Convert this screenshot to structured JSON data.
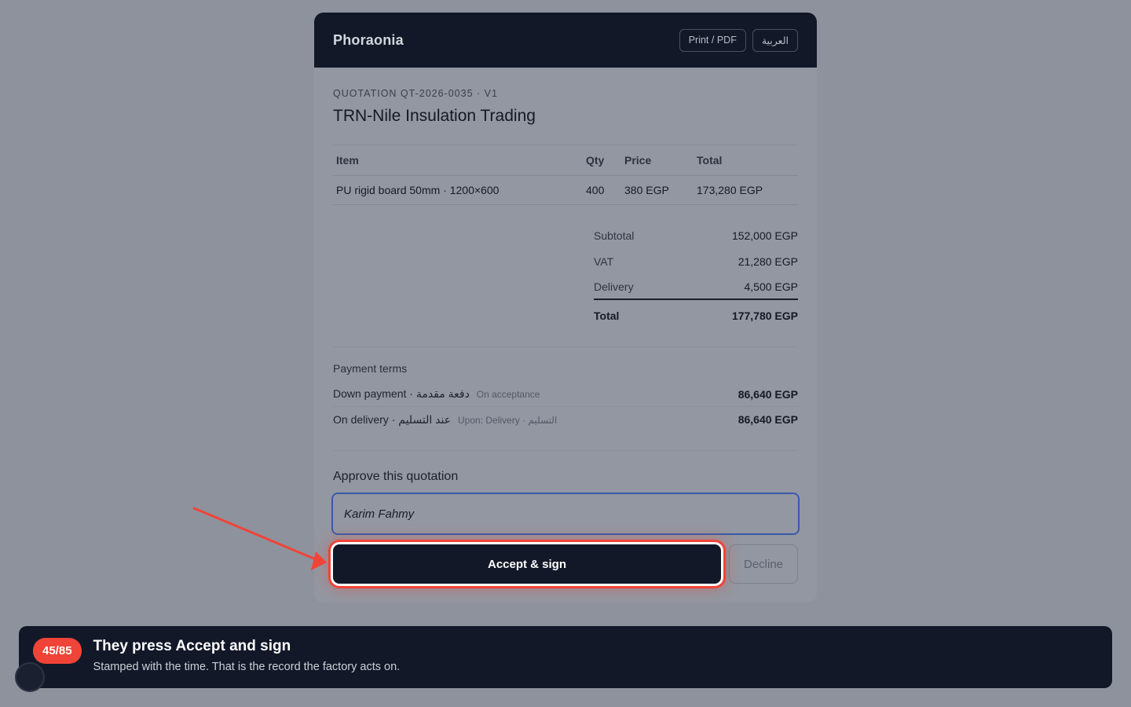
{
  "header": {
    "brand": "Phoraonia",
    "print_label": "Print / PDF",
    "language_label": "العربية"
  },
  "quote": {
    "id_line": "QUOTATION QT-2026-0035 · V1",
    "client": "TRN-Nile Insulation Trading"
  },
  "items_table": {
    "columns": [
      "Item",
      "Qty",
      "Price",
      "Total"
    ],
    "rows": [
      {
        "item": "PU rigid board 50mm · 1200×600",
        "qty": "400",
        "price": "380 EGP",
        "total": "173,280 EGP"
      }
    ]
  },
  "totals": {
    "subtotal_label": "Subtotal",
    "subtotal": "152,000 EGP",
    "vat_label": "VAT",
    "vat": "21,280 EGP",
    "delivery_label": "Delivery",
    "delivery": "4,500 EGP",
    "total_label": "Total",
    "total": "177,780 EGP"
  },
  "payment_terms": {
    "title": "Payment terms",
    "rows": [
      {
        "label": "Down payment · دفعة مقدمة",
        "sub": "On acceptance",
        "amount": "86,640 EGP"
      },
      {
        "label": "On delivery · عند التسليم",
        "sub": "Upon: Delivery · التسليم",
        "amount": "86,640 EGP"
      }
    ]
  },
  "approval": {
    "title": "Approve this quotation",
    "signature_value": "Karim Fahmy",
    "accept_label": "Accept & sign",
    "decline_label": "Decline"
  },
  "banner": {
    "step": "45/85",
    "title": "They press Accept and sign",
    "description": "Stamped with the time. That is the record the factory acts on."
  },
  "colors": {
    "dark": "#121828",
    "highlight": "#f04438",
    "focus_border": "#3a5aa8"
  },
  "icons": {
    "annotation": "arrow-pointer-icon"
  }
}
